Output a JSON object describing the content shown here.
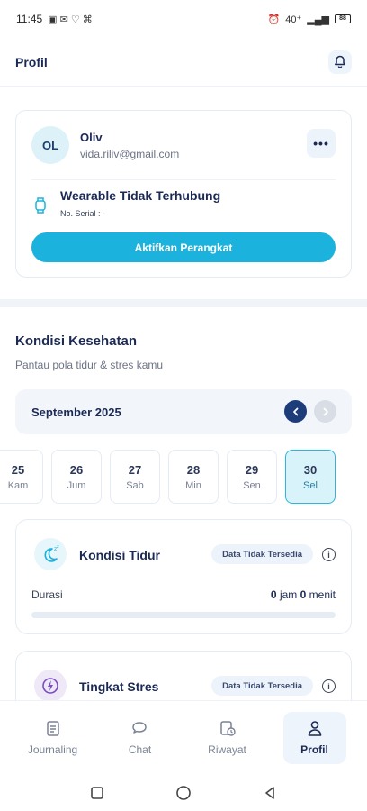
{
  "status_bar": {
    "time": "11:45",
    "network": "40⁺",
    "battery": "88"
  },
  "header": {
    "title": "Profil"
  },
  "profile": {
    "initials": "OL",
    "name": "Oliv",
    "email": "vida.riliv@gmail.com",
    "more_label": "•••",
    "wearable_title": "Wearable Tidak Terhubung",
    "serial_label": "No. Serial : -",
    "activate_button": "Aktifkan Perangkat"
  },
  "health": {
    "title": "Kondisi Kesehatan",
    "subtitle": "Pantau pola tidur & stres kamu",
    "month": "September 2025",
    "days": [
      {
        "num": "25",
        "name": "Kam",
        "active": false
      },
      {
        "num": "26",
        "name": "Jum",
        "active": false
      },
      {
        "num": "27",
        "name": "Sab",
        "active": false
      },
      {
        "num": "28",
        "name": "Min",
        "active": false
      },
      {
        "num": "29",
        "name": "Sen",
        "active": false
      },
      {
        "num": "30",
        "name": "Sel",
        "active": true
      }
    ],
    "sleep": {
      "title": "Kondisi Tidur",
      "badge": "Data Tidak Tersedia",
      "duration_label": "Durasi",
      "hours": "0",
      "hours_unit": "jam",
      "minutes": "0",
      "minutes_unit": "menit",
      "progress": 0
    },
    "stress": {
      "title": "Tingkat Stres",
      "badge": "Data Tidak Tersedia"
    }
  },
  "bottom_nav": {
    "items": [
      {
        "label": "Journaling",
        "icon": "journal-icon"
      },
      {
        "label": "Chat",
        "icon": "chat-icon"
      },
      {
        "label": "Riwayat",
        "icon": "history-icon"
      },
      {
        "label": "Profil",
        "icon": "person-icon",
        "active": true
      }
    ]
  },
  "colors": {
    "accent": "#1bb3dd",
    "navy": "#1b2a55",
    "active_day_bg": "#d9f3fa"
  }
}
